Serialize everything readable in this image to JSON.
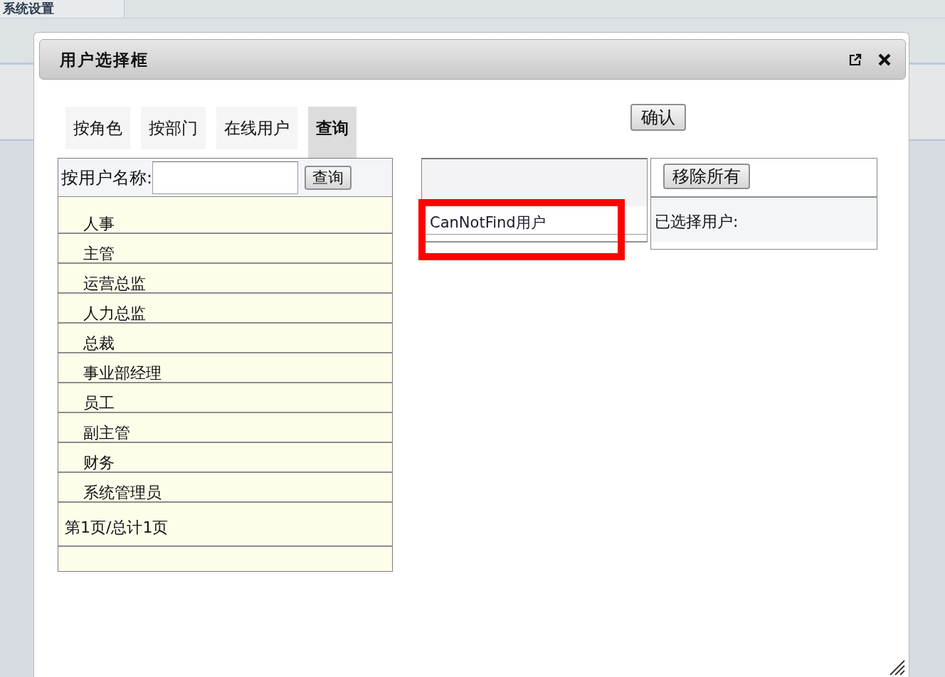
{
  "background_tab": {
    "label": "系统设置"
  },
  "dialog": {
    "title": "用户选择框"
  },
  "tabs": [
    {
      "label": "按角色",
      "selected": false
    },
    {
      "label": "按部门",
      "selected": false
    },
    {
      "label": "在线用户",
      "selected": false
    },
    {
      "label": "查询",
      "selected": true
    }
  ],
  "search": {
    "label": "按用户名称:",
    "button": "查询"
  },
  "roles": [
    "人事",
    "主管",
    "运营总监",
    "人力总监",
    "总裁",
    "事业部经理",
    "员工",
    "副主管",
    "财务",
    "系统管理员"
  ],
  "pagination": "第1页/总计1页",
  "confirm_button": "确认",
  "candidates": [
    {
      "label": "CanNotFind用户",
      "highlighted": true
    }
  ],
  "selected_panel": {
    "remove_all_button": "移除所有",
    "label": "已选择用户:"
  }
}
